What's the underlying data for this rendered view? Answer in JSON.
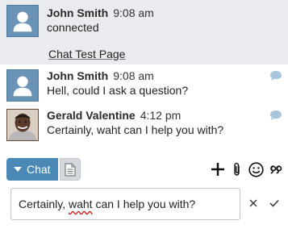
{
  "messages": [
    {
      "name": "John Smith",
      "time": "9:08 am",
      "text": "connected",
      "link": "Chat Test Page",
      "avatar": "default-user"
    },
    {
      "name": "John Smith",
      "time": "9:08 am",
      "text": "Hell, could I ask a question?",
      "avatar": "default-user"
    },
    {
      "name": "Gerald Valentine",
      "time": "4:12 pm",
      "text": "Certainly, waht can I help you with?",
      "avatar": "photo"
    }
  ],
  "toolbar": {
    "chat_label": "Chat",
    "icons": [
      "plus-icon",
      "attachment-icon",
      "emoji-icon",
      "quote-icon"
    ]
  },
  "composer": {
    "value_before": "Certainly, ",
    "value_misspelled": "waht",
    "value_after": " can I help you with?"
  },
  "colors": {
    "accent": "#4a89b6",
    "system_bg": "#e9ebee",
    "bubble": "#a9c6dd"
  }
}
